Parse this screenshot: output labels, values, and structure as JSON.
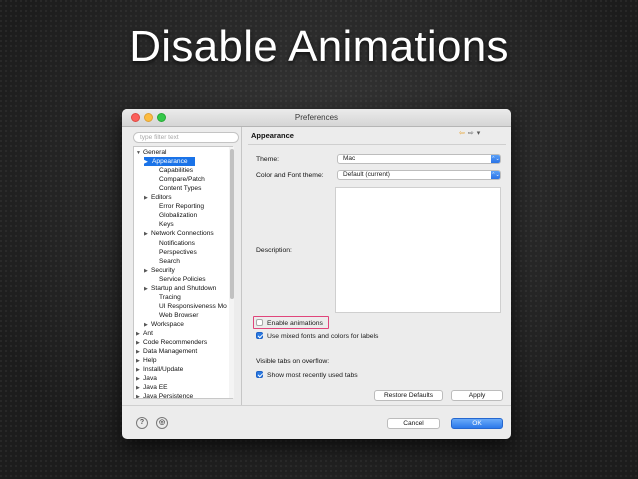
{
  "slide": {
    "title": "Disable Animations"
  },
  "window": {
    "title": "Preferences",
    "filter_placeholder": "type filter text",
    "tree": [
      {
        "label": "General",
        "arrow": "▼",
        "level": 0
      },
      {
        "label": "Appearance",
        "arrow": "▶",
        "level": 1,
        "selected": true
      },
      {
        "label": "Capabilities",
        "arrow": "",
        "level": 2
      },
      {
        "label": "Compare/Patch",
        "arrow": "",
        "level": 2
      },
      {
        "label": "Content Types",
        "arrow": "",
        "level": 2
      },
      {
        "label": "Editors",
        "arrow": "▶",
        "level": 1
      },
      {
        "label": "Error Reporting",
        "arrow": "",
        "level": 2
      },
      {
        "label": "Globalization",
        "arrow": "",
        "level": 2
      },
      {
        "label": "Keys",
        "arrow": "",
        "level": 2
      },
      {
        "label": "Network Connections",
        "arrow": "▶",
        "level": 1
      },
      {
        "label": "Notifications",
        "arrow": "",
        "level": 2
      },
      {
        "label": "Perspectives",
        "arrow": "",
        "level": 2
      },
      {
        "label": "Search",
        "arrow": "",
        "level": 2
      },
      {
        "label": "Security",
        "arrow": "▶",
        "level": 1
      },
      {
        "label": "Service Policies",
        "arrow": "",
        "level": 2
      },
      {
        "label": "Startup and Shutdown",
        "arrow": "▶",
        "level": 1
      },
      {
        "label": "Tracing",
        "arrow": "",
        "level": 2
      },
      {
        "label": "UI Responsiveness Mo",
        "arrow": "",
        "level": 2
      },
      {
        "label": "Web Browser",
        "arrow": "",
        "level": 2
      },
      {
        "label": "Workspace",
        "arrow": "▶",
        "level": 1
      },
      {
        "label": "Ant",
        "arrow": "▶",
        "level": 0
      },
      {
        "label": "Code Recommenders",
        "arrow": "▶",
        "level": 0
      },
      {
        "label": "Data Management",
        "arrow": "▶",
        "level": 0
      },
      {
        "label": "Help",
        "arrow": "▶",
        "level": 0
      },
      {
        "label": "Install/Update",
        "arrow": "▶",
        "level": 0
      },
      {
        "label": "Java",
        "arrow": "▶",
        "level": 0
      },
      {
        "label": "Java EE",
        "arrow": "▶",
        "level": 0
      },
      {
        "label": "Java Persistence",
        "arrow": "▶",
        "level": 0
      }
    ],
    "page_title": "Appearance",
    "theme_label": "Theme:",
    "theme_value": "Mac",
    "color_font_label": "Color and Font theme:",
    "color_font_value": "Default (current)",
    "description_label": "Description:",
    "enable_animations": {
      "label": "Enable animations",
      "checked": false
    },
    "mixed_fonts": {
      "label": "Use mixed fonts and colors for labels",
      "checked": true
    },
    "visible_tabs_label": "Visible tabs on overflow:",
    "recent_tabs": {
      "label": "Show most recently used tabs",
      "checked": true
    },
    "restore_defaults": "Restore Defaults",
    "apply": "Apply",
    "cancel": "Cancel",
    "ok": "OK",
    "help_glyph": "?",
    "import_glyph": "◎",
    "nav_back": "⇦",
    "nav_forward": "⇨",
    "nav_menu": "▾",
    "combo_caret": "⌃⌄"
  }
}
